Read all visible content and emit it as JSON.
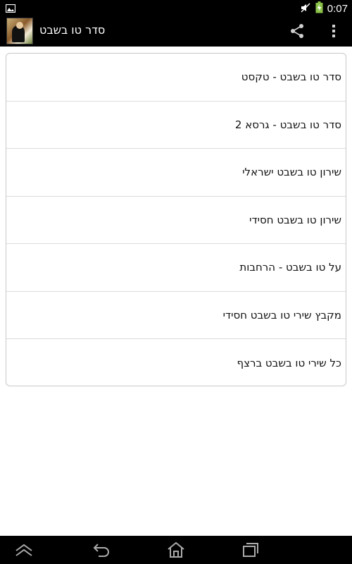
{
  "status_bar": {
    "time": "0:07",
    "icons": [
      "picture-notification-icon",
      "mute-icon",
      "battery-charging-icon"
    ]
  },
  "action_bar": {
    "title": "סדר טו בשבט",
    "icons": [
      "app-logo",
      "share-icon",
      "overflow-menu-icon"
    ]
  },
  "menu": {
    "items": [
      {
        "label": "סדר טו בשבט - טקסט"
      },
      {
        "label": "סדר טו בשבט - גרסא 2"
      },
      {
        "label": "שירון טו בשבט ישראלי"
      },
      {
        "label": "שירון טו בשבט חסידי"
      },
      {
        "label": "על טו בשבט - הרחבות"
      },
      {
        "label": "מקבץ שירי טו בשבט חסידי"
      },
      {
        "label": "כל שירי טו בשבט ברצף"
      }
    ]
  },
  "nav_bar": {
    "icons": [
      "scroll-up-icon",
      "back-icon",
      "home-icon",
      "recent-apps-icon"
    ]
  },
  "colors": {
    "bar_background": "#000000",
    "card_border": "#c8c8c8",
    "divider": "#dcdcdc",
    "battery_green": "#8bc34a"
  }
}
